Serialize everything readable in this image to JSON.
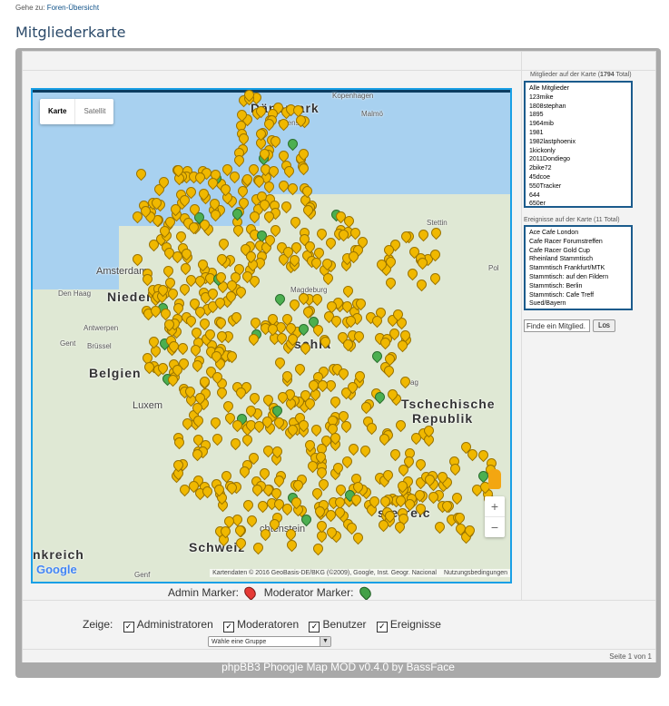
{
  "breadcrumb": {
    "prefix": "Gehe zu:",
    "link": "Foren-Übersicht"
  },
  "page_title": "Mitgliederkarte",
  "map": {
    "types": [
      "Karte",
      "Satellit"
    ],
    "labels": {
      "daenemark": "Dänemark",
      "kopenhagen": "Kopenhagen",
      "malmoe": "Malmö",
      "odense": "Odense",
      "stettin": "Stettin",
      "amsterdam": "Amsterdam",
      "den_haag": "Den Haag",
      "niederlande": "Niederl",
      "antwerpen": "Antwerpen",
      "gent": "Gent",
      "bruessel": "Brüssel",
      "belgien": "Belgien",
      "luxem": "Luxem",
      "magdeburg": "Magdeburg",
      "deutschland": "schla",
      "prag": "Prag",
      "tschechische": "Tschechische",
      "republik": "Republik",
      "oesterreich": "sterreic",
      "liechtenstein": "chtenstein",
      "schweiz": "Schweiz",
      "frankreich": "nkreich",
      "genf": "Genf",
      "pol": "Pol"
    },
    "google_logo": "Google",
    "attribution": "Kartendaten © 2016 GeoBasis-DE/BKG (©2009), Google, Inst. Geogr. Nacional",
    "terms": "Nutzungsbedingungen",
    "zoom_in": "+",
    "zoom_out": "−"
  },
  "legend": {
    "admin": "Admin Marker:",
    "moderator": "Moderator Marker:"
  },
  "filters": {
    "label": "Zeige:",
    "items": [
      "Administratoren",
      "Moderatoren",
      "Benutzer",
      "Ereignisse"
    ],
    "check_glyph": "✓"
  },
  "group_select": {
    "value": "Wähle eine Gruppe",
    "arrow": "▼"
  },
  "page_count": "Seite 1 von 1",
  "footer": "phpBB3 Phoogle Map MOD v0.4.0 by BassFace",
  "sidebar": {
    "members_label_prefix": "Mitglieder auf der Karte (",
    "members_count": "1794",
    "members_label_suffix": " Total)",
    "members": [
      "Alle Mitglieder",
      "123mike",
      "1808stephan",
      "1895",
      "1964mib",
      "1981",
      "1982lastphoenix",
      "1kickonly",
      "2011Dondiego",
      "2bike72",
      "45dcoe",
      "550Tracker",
      "644",
      "650er"
    ],
    "events_label": "Ereignisse auf der Karte (11 Total)",
    "events": [
      "Ace Cafe London",
      "Cafe Racer Forumstreffen",
      "Cafe Racer Gold Cup",
      "Rheinland Stammtisch",
      "Stammtisch Frankfurt/MTK",
      "Stammtisch: auf den Fildern",
      "Stammtisch: Berlin",
      "Stammtisch: Cafe Treff",
      "Sued/Bayern"
    ],
    "search_placeholder": "Finde ein Mitglied.",
    "search_button": "Los"
  }
}
